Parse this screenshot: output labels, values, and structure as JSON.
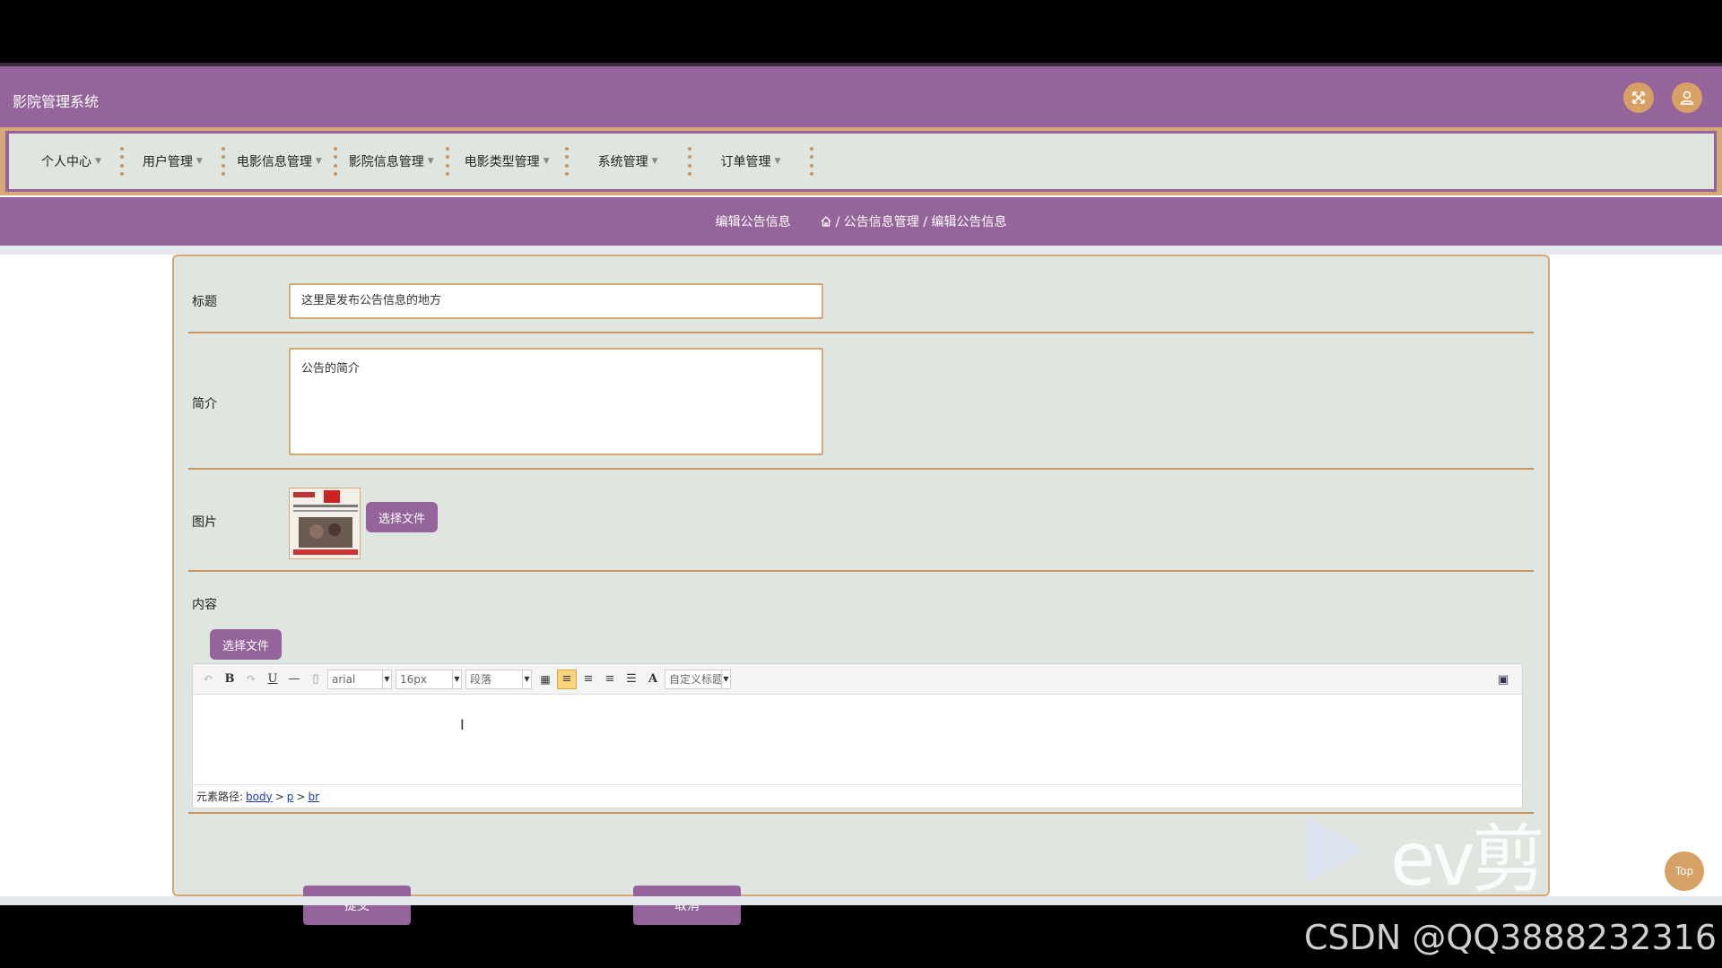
{
  "app": {
    "title": "影院管理系统"
  },
  "header": {
    "fullscreen_icon": "fullscreen-icon",
    "user_icon": "user-icon"
  },
  "nav": {
    "items": [
      {
        "label": "个人中心"
      },
      {
        "label": "用户管理"
      },
      {
        "label": "电影信息管理"
      },
      {
        "label": "影院信息管理"
      },
      {
        "label": "电影类型管理"
      },
      {
        "label": "系统管理"
      },
      {
        "label": "订单管理"
      }
    ]
  },
  "breadcrumb": {
    "current": "编辑公告信息",
    "path": "/ 公告信息管理 / 编辑公告信息"
  },
  "form": {
    "title_label": "标题",
    "title_value": "这里是发布公告信息的地方",
    "intro_label": "简介",
    "intro_value": "公告的简介",
    "image_label": "图片",
    "image_button": "选择文件",
    "content_label": "内容",
    "content_button": "选择文件",
    "submit_label": "提交",
    "cancel_label": "取消"
  },
  "editor": {
    "font_family": "arial",
    "font_size": "16px",
    "paragraph": "段落",
    "custom_title": "自定义标题",
    "path_label": "元素路径:",
    "path_items": [
      "body",
      "p",
      "br"
    ]
  },
  "float": {
    "top_label": "Top"
  },
  "overlay": {
    "watermark_text": "ev剪",
    "csdn_text": "CSDN @QQ3888232316"
  },
  "colors": {
    "brand": "#94649a",
    "accent": "#d6a878",
    "form_bg": "#dfe6e0"
  }
}
